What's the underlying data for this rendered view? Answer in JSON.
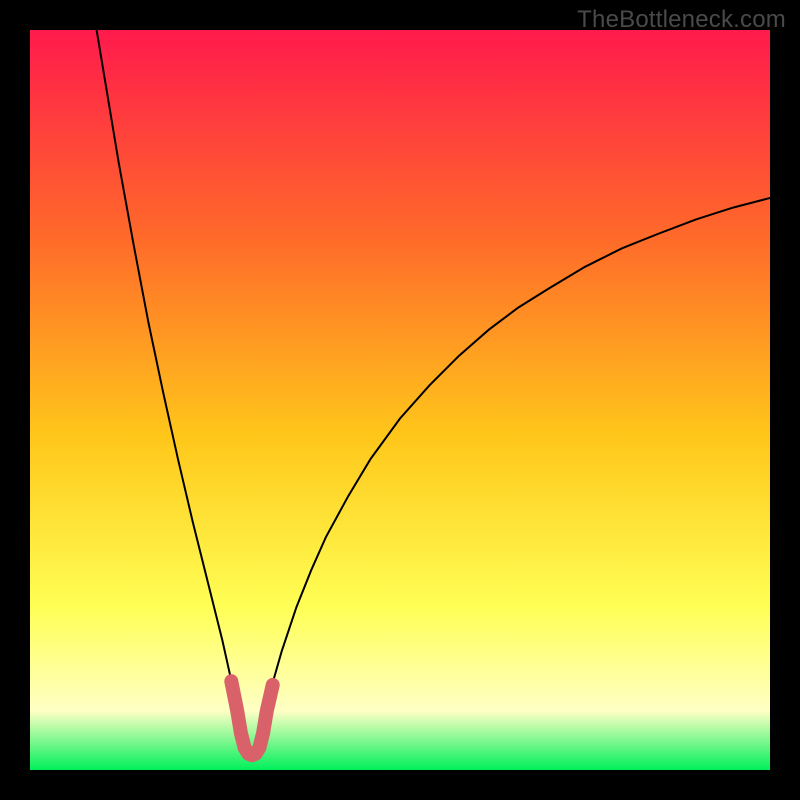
{
  "watermark": "TheBottleneck.com",
  "colors": {
    "frame": "#000000",
    "gradient_top": "#ff1a4c",
    "gradient_mid_upper": "#ff6a2a",
    "gradient_mid": "#ffc71a",
    "gradient_lower": "#ffff55",
    "gradient_pale": "#ffffc5",
    "gradient_bottom": "#00f05a",
    "curve": "#000000",
    "marker": "#d9626a"
  },
  "chart_data": {
    "type": "line",
    "title": "",
    "xlabel": "",
    "ylabel": "",
    "xlim": [
      0,
      100
    ],
    "ylim": [
      0,
      100
    ],
    "min_point_x": 30,
    "series": [
      {
        "name": "curve",
        "points": [
          {
            "x": 9.0,
            "y": 100.0
          },
          {
            "x": 10.0,
            "y": 94.0
          },
          {
            "x": 12.0,
            "y": 82.0
          },
          {
            "x": 14.0,
            "y": 71.0
          },
          {
            "x": 16.0,
            "y": 60.5
          },
          {
            "x": 18.0,
            "y": 51.0
          },
          {
            "x": 20.0,
            "y": 42.0
          },
          {
            "x": 22.0,
            "y": 33.5
          },
          {
            "x": 24.0,
            "y": 25.5
          },
          {
            "x": 26.0,
            "y": 17.5
          },
          {
            "x": 27.0,
            "y": 13.0
          },
          {
            "x": 28.0,
            "y": 8.0
          },
          {
            "x": 28.5,
            "y": 5.0
          },
          {
            "x": 29.0,
            "y": 3.0
          },
          {
            "x": 29.5,
            "y": 2.2
          },
          {
            "x": 30.0,
            "y": 2.0
          },
          {
            "x": 30.5,
            "y": 2.2
          },
          {
            "x": 31.0,
            "y": 3.0
          },
          {
            "x": 31.5,
            "y": 5.0
          },
          {
            "x": 32.0,
            "y": 8.0
          },
          {
            "x": 33.0,
            "y": 12.5
          },
          {
            "x": 34.0,
            "y": 16.0
          },
          {
            "x": 36.0,
            "y": 22.0
          },
          {
            "x": 38.0,
            "y": 27.0
          },
          {
            "x": 40.0,
            "y": 31.5
          },
          {
            "x": 43.0,
            "y": 37.0
          },
          {
            "x": 46.0,
            "y": 42.0
          },
          {
            "x": 50.0,
            "y": 47.5
          },
          {
            "x": 54.0,
            "y": 52.0
          },
          {
            "x": 58.0,
            "y": 56.0
          },
          {
            "x": 62.0,
            "y": 59.5
          },
          {
            "x": 66.0,
            "y": 62.5
          },
          {
            "x": 70.0,
            "y": 65.0
          },
          {
            "x": 75.0,
            "y": 68.0
          },
          {
            "x": 80.0,
            "y": 70.5
          },
          {
            "x": 85.0,
            "y": 72.5
          },
          {
            "x": 90.0,
            "y": 74.4
          },
          {
            "x": 95.0,
            "y": 76.0
          },
          {
            "x": 100.0,
            "y": 77.3
          }
        ]
      },
      {
        "name": "marker-segment",
        "points": [
          {
            "x": 27.2,
            "y": 12.0
          },
          {
            "x": 28.0,
            "y": 8.0
          },
          {
            "x": 28.5,
            "y": 5.0
          },
          {
            "x": 29.0,
            "y": 3.0
          },
          {
            "x": 29.5,
            "y": 2.2
          },
          {
            "x": 30.0,
            "y": 2.0
          },
          {
            "x": 30.5,
            "y": 2.2
          },
          {
            "x": 31.0,
            "y": 3.0
          },
          {
            "x": 31.5,
            "y": 5.0
          },
          {
            "x": 32.0,
            "y": 8.0
          },
          {
            "x": 32.8,
            "y": 11.5
          }
        ]
      }
    ]
  }
}
